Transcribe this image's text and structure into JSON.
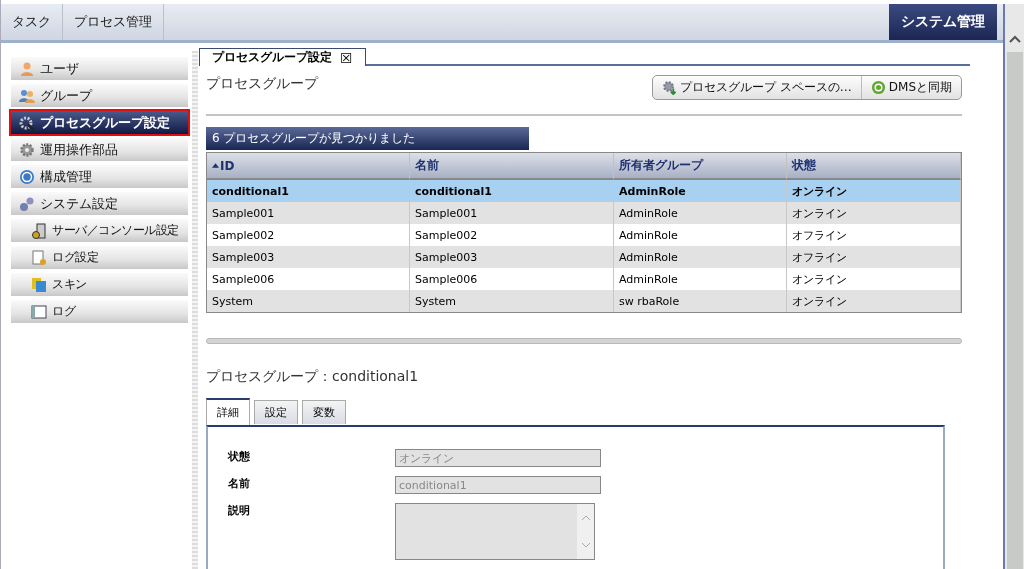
{
  "top_tabs": [
    {
      "label": "タスク"
    },
    {
      "label": "プロセス管理"
    }
  ],
  "top_right": {
    "label": "システム管理",
    "selected": true
  },
  "sidebar": {
    "items": [
      {
        "label": "ユーザ",
        "selected": false
      },
      {
        "label": "グループ",
        "selected": false
      },
      {
        "label": "プロセスグループ設定",
        "selected": true
      },
      {
        "label": "運用操作部品",
        "selected": false
      },
      {
        "label": "構成管理",
        "selected": false
      },
      {
        "label": "システム設定",
        "selected": false,
        "children": [
          {
            "label": "サーバ／コンソール設定",
            "selected": false
          },
          {
            "label": "ログ設定",
            "selected": false
          },
          {
            "label": "スキン",
            "selected": false
          },
          {
            "label": "ログ",
            "selected": false
          }
        ]
      }
    ]
  },
  "content_tab": {
    "label": "プロセスグループ設定",
    "close": "☒"
  },
  "heading": "プロセスグループ",
  "buttons": [
    {
      "label": "プロセスグループ スペースの…"
    },
    {
      "label": "DMSと同期"
    }
  ],
  "table": {
    "caption": "6 プロセスグループが見つかりました",
    "columns": [
      {
        "label": "ID",
        "sorted": true
      },
      {
        "label": "名前",
        "sorted": false
      },
      {
        "label": "所有者グループ",
        "sorted": false
      },
      {
        "label": "状態",
        "sorted": false
      }
    ],
    "rows": [
      {
        "cells": [
          "conditional1",
          "conditional1",
          "AdminRole",
          "オンライン"
        ],
        "selected": true
      },
      {
        "cells": [
          "Sample001",
          "Sample001",
          "AdminRole",
          "オンライン"
        ],
        "selected": false
      },
      {
        "cells": [
          "Sample002",
          "Sample002",
          "AdminRole",
          "オフライン"
        ],
        "selected": false
      },
      {
        "cells": [
          "Sample003",
          "Sample003",
          "AdminRole",
          "オフライン"
        ],
        "selected": false
      },
      {
        "cells": [
          "Sample006",
          "Sample006",
          "AdminRole",
          "オンライン"
        ],
        "selected": false
      },
      {
        "cells": [
          "System",
          "System",
          "sw rbaRole",
          "オンライン"
        ],
        "selected": false
      }
    ]
  },
  "detail": {
    "title": "プロセスグループ：conditional1",
    "tabs": [
      {
        "label": "詳細",
        "selected": true
      },
      {
        "label": "設定",
        "selected": false
      },
      {
        "label": "変数",
        "selected": false
      }
    ],
    "fields": [
      {
        "label": "状態",
        "value": "オンライン",
        "kind": "input"
      },
      {
        "label": "名前",
        "value": "conditional1",
        "kind": "input"
      },
      {
        "label": "説明",
        "kind": "textarea"
      }
    ]
  }
}
